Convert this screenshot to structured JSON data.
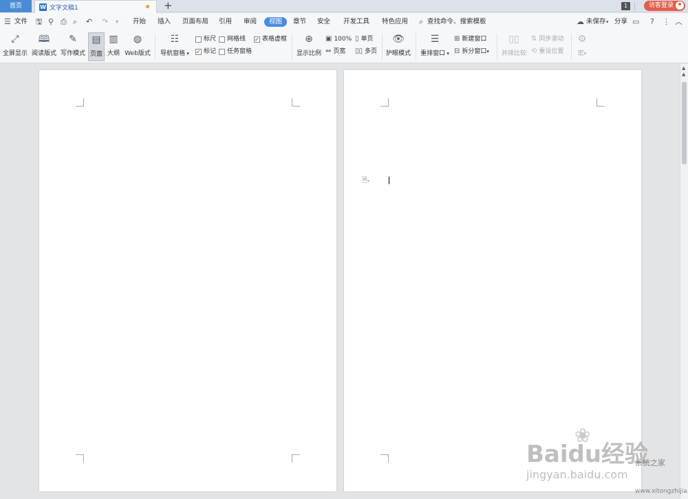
{
  "tabs": {
    "home": "首页",
    "document": "文字文稿1",
    "new_tab": "+",
    "count": "1",
    "login": "访客登录"
  },
  "menu": {
    "file": "文件",
    "items": [
      "开始",
      "插入",
      "页面布局",
      "引用",
      "审阅",
      "视图",
      "章节",
      "安全",
      "开发工具",
      "特色应用"
    ],
    "active": "视图",
    "search": "查找命令、搜索模板",
    "save_status": "未保存",
    "share": "分享"
  },
  "ribbon": {
    "fullscreen": "全屏显示",
    "read_mode": "阅读版式",
    "write_mode": "写作模式",
    "page": "页面",
    "outline": "大纲",
    "web": "Web版式",
    "nav_pane": "导航窗格",
    "ruler": "标尺",
    "gridlines": "网格线",
    "table_border": "表格虚框",
    "marks": "标记",
    "task_pane": "任务窗格",
    "zoom_ratio": "显示比例",
    "zoom_100": "100%",
    "page_width": "页宽",
    "single_page": "单页",
    "multi_page": "多页",
    "eye_mode": "护眼模式",
    "arrange_windows": "重排窗口",
    "new_window": "新建窗口",
    "split_window": "拆分窗口",
    "side_by_side": "并排比较",
    "sync_scroll": "同步滚动",
    "reset_position": "重设位置",
    "macro": "宏"
  },
  "checkbox_state": {
    "ruler": false,
    "gridlines": false,
    "table_border": true,
    "marks": true,
    "task_pane": false
  },
  "watermark": {
    "brand": "Baidu经验",
    "url": "jingyan.baidu.com",
    "site_name": "系统之家",
    "site_url": "www.xitongzhijia.net"
  },
  "colors": {
    "accent": "#4b8be0",
    "login": "#e25f4b",
    "home_tab": "#4a8bd6"
  }
}
